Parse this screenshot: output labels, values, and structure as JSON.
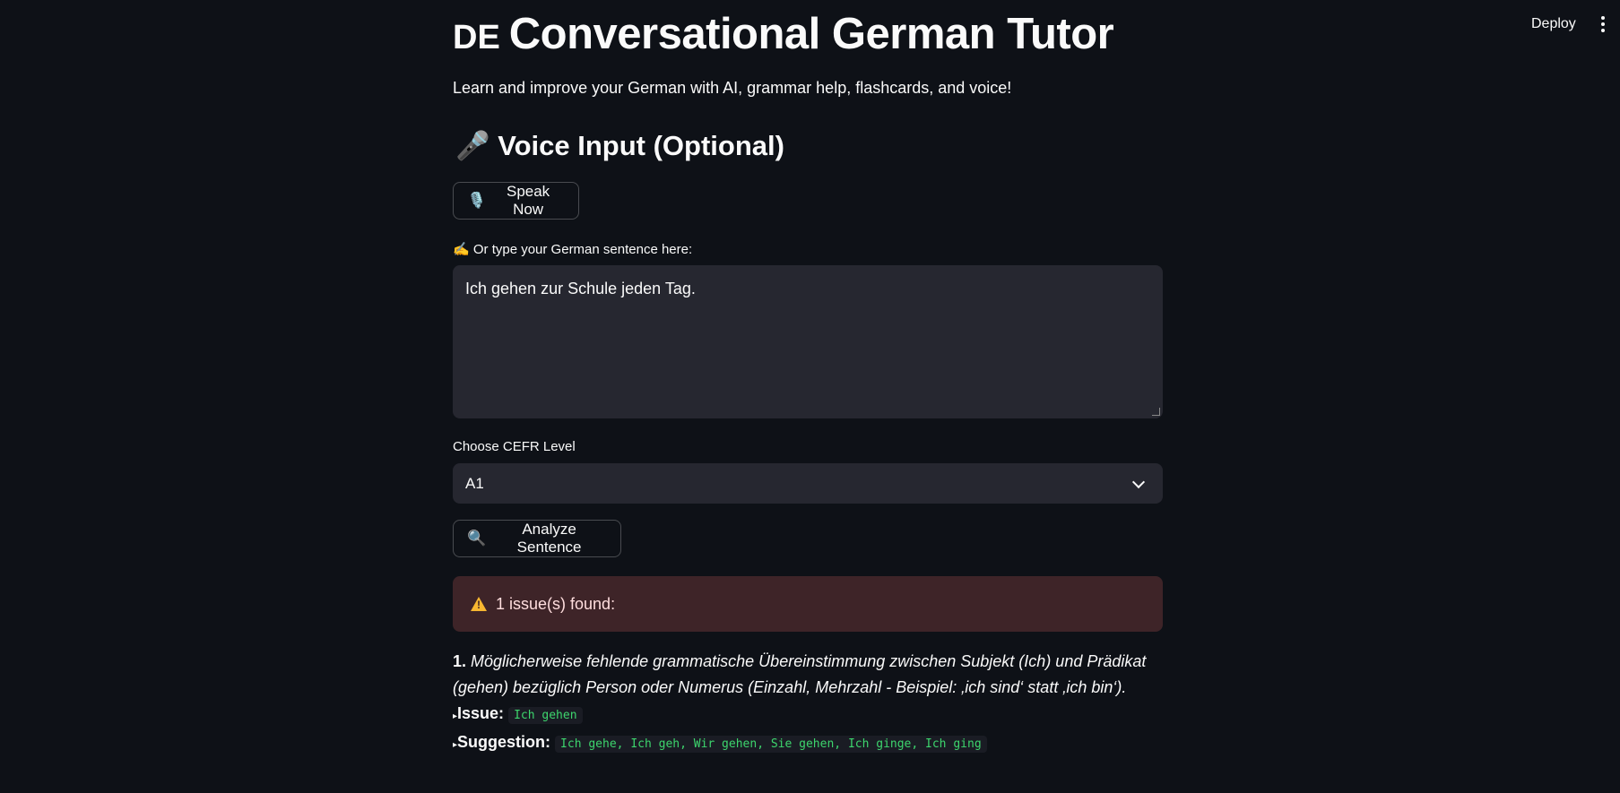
{
  "header": {
    "deploy_label": "Deploy"
  },
  "main": {
    "flag_text": "DE",
    "title": "Conversational German Tutor",
    "subtitle": "Learn and improve your German with AI, grammar help, flashcards, and voice!",
    "voice_heading_icon": "🎤",
    "voice_heading": "Voice Input (Optional)",
    "speak_button_icon": "🎙️",
    "speak_button_label": "Speak Now",
    "type_label_icon": "✍️",
    "type_label": "Or type your German sentence here:",
    "sentence_value": "Ich gehen zur Schule jeden Tag.",
    "level_label": "Choose CEFR Level",
    "level_value": "A1",
    "analyze_button_icon": "🔍",
    "analyze_button_label": "Analyze Sentence",
    "alert_text": "1 issue(s) found:",
    "issues": [
      {
        "number": "1.",
        "message": "Möglicherweise fehlende grammatische Übereinstimmung zwischen Subjekt (Ich) und Prädikat (gehen) bezüglich Person oder Numerus (Einzahl, Mehrzahl - Beispiel: ‚ich sind‘ statt ‚ich bin‘).",
        "issue_label": "Issue:",
        "issue_value": "Ich gehen",
        "suggestion_label": "Suggestion:",
        "suggestion_value": "Ich gehe, Ich geh, Wir gehen, Sie gehen, Ich ginge, Ich ging"
      }
    ]
  },
  "colors": {
    "background": "#0e1117",
    "input_bg": "#262730",
    "alert_bg": "#3e2428",
    "code_green": "#3dd56d",
    "warning_yellow": "#f7b731"
  },
  "icons": [
    "kebab-menu-icon",
    "microphone-icon",
    "studio-microphone-icon",
    "writing-hand-icon",
    "chevron-down-icon",
    "magnifier-icon",
    "warning-icon"
  ]
}
